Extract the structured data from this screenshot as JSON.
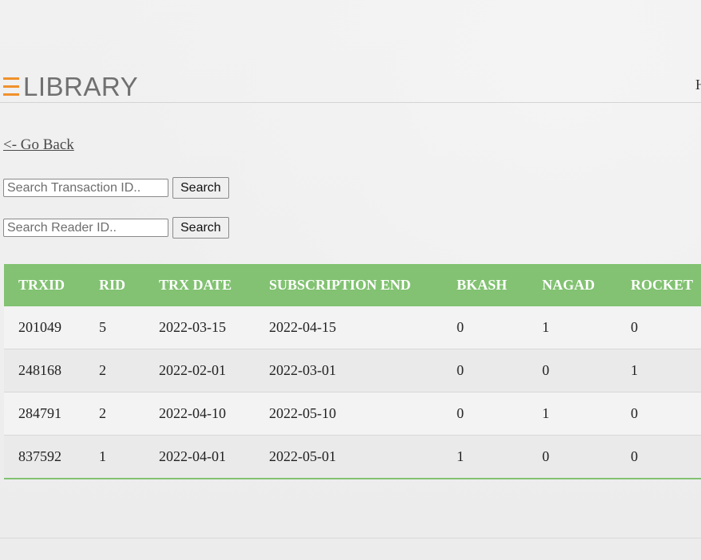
{
  "header": {
    "logo_text": "LIBRARY",
    "nav_fragment": "H",
    "accent_color": "#f0912b"
  },
  "go_back": "<- Go Back",
  "search": {
    "transaction_placeholder": "Search Transaction ID..",
    "reader_placeholder": "Search Reader ID..",
    "button_label": "Search"
  },
  "table": {
    "header_color": "#82c272",
    "columns": [
      "TRXID",
      "RID",
      "TRX DATE",
      "SUBSCRIPTION END",
      "BKASH",
      "NAGAD",
      "ROCKET"
    ],
    "rows": [
      [
        "201049",
        "5",
        "2022-03-15",
        "2022-04-15",
        "0",
        "1",
        "0"
      ],
      [
        "248168",
        "2",
        "2022-02-01",
        "2022-03-01",
        "0",
        "0",
        "1"
      ],
      [
        "284791",
        "2",
        "2022-04-10",
        "2022-05-10",
        "0",
        "1",
        "0"
      ],
      [
        "837592",
        "1",
        "2022-04-01",
        "2022-05-01",
        "1",
        "0",
        "0"
      ]
    ]
  }
}
